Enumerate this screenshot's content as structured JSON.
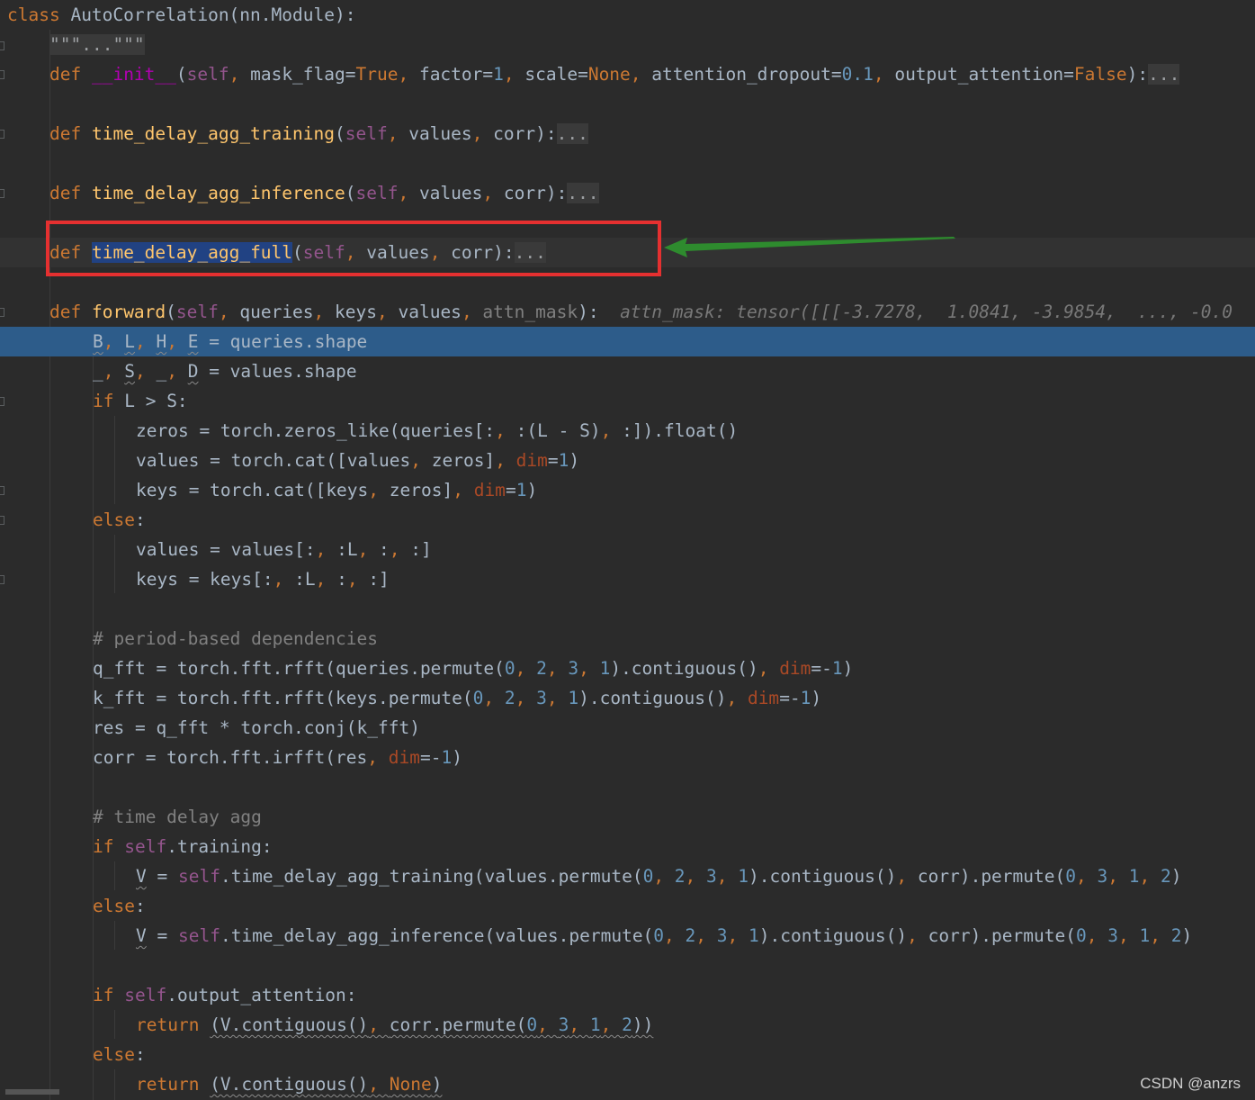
{
  "editor": {
    "lines": [
      {
        "segments": [
          {
            "t": "class ",
            "c": "kw"
          },
          {
            "t": "AutoCorrelation(nn.Module):"
          }
        ]
      },
      {
        "segments": [
          {
            "t": "\"\"\"...\"\"\"",
            "c": "fold-dots"
          }
        ]
      },
      {
        "segments": [
          {
            "t": "def ",
            "c": "kw"
          },
          {
            "t": "__init__",
            "c": "dec"
          },
          {
            "t": "("
          },
          {
            "t": "self",
            "c": "sf"
          },
          {
            "t": ", ",
            "c": "kw"
          },
          {
            "t": "mask_flag="
          },
          {
            "t": "True",
            "c": "kw"
          },
          {
            "t": ", ",
            "c": "kw"
          },
          {
            "t": "factor="
          },
          {
            "t": "1",
            "c": "nm"
          },
          {
            "t": ", ",
            "c": "kw"
          },
          {
            "t": "scale="
          },
          {
            "t": "None",
            "c": "kw"
          },
          {
            "t": ", ",
            "c": "kw"
          },
          {
            "t": "attention_dropout="
          },
          {
            "t": "0.1",
            "c": "nm"
          },
          {
            "t": ", ",
            "c": "kw"
          },
          {
            "t": "output_attention="
          },
          {
            "t": "False",
            "c": "kw"
          },
          {
            "t": "):"
          },
          {
            "t": "...",
            "c": "fold-dots"
          }
        ]
      },
      {
        "segments": []
      },
      {
        "segments": [
          {
            "t": "def ",
            "c": "kw"
          },
          {
            "t": "time_delay_agg_training",
            "c": "fn"
          },
          {
            "t": "("
          },
          {
            "t": "self",
            "c": "sf"
          },
          {
            "t": ", ",
            "c": "kw"
          },
          {
            "t": "values"
          },
          {
            "t": ", ",
            "c": "kw"
          },
          {
            "t": "corr):"
          },
          {
            "t": "...",
            "c": "fold-dots"
          }
        ]
      },
      {
        "segments": []
      },
      {
        "segments": [
          {
            "t": "def ",
            "c": "kw"
          },
          {
            "t": "time_delay_agg_inference",
            "c": "fn"
          },
          {
            "t": "("
          },
          {
            "t": "self",
            "c": "sf"
          },
          {
            "t": ", ",
            "c": "kw"
          },
          {
            "t": "values"
          },
          {
            "t": ", ",
            "c": "kw"
          },
          {
            "t": "corr):"
          },
          {
            "t": "...",
            "c": "fold-dots"
          }
        ]
      },
      {
        "segments": []
      },
      {
        "segments": [
          {
            "t": "def ",
            "c": "kw"
          },
          {
            "t": "time_delay_agg_full",
            "c": "fn ident-hl"
          },
          {
            "t": "("
          },
          {
            "t": "self",
            "c": "sf"
          },
          {
            "t": ", ",
            "c": "kw"
          },
          {
            "t": "values"
          },
          {
            "t": ", ",
            "c": "kw"
          },
          {
            "t": "corr):"
          },
          {
            "t": "...",
            "c": "fold-dots"
          }
        ]
      },
      {
        "segments": []
      },
      {
        "segments": [
          {
            "t": "def ",
            "c": "kw"
          },
          {
            "t": "forward",
            "c": "fn"
          },
          {
            "t": "("
          },
          {
            "t": "self",
            "c": "sf"
          },
          {
            "t": ", ",
            "c": "kw"
          },
          {
            "t": "queries"
          },
          {
            "t": ", ",
            "c": "kw"
          },
          {
            "t": "keys"
          },
          {
            "t": ", ",
            "c": "kw"
          },
          {
            "t": "values"
          },
          {
            "t": ", ",
            "c": "kw"
          },
          {
            "t": "attn_mask",
            "c": "cm"
          },
          {
            "t": "):  "
          },
          {
            "t": "attn_mask: tensor([[[-3.7278,  1.0841, -3.9854,  ..., -0.0",
            "c": "hint"
          }
        ]
      },
      {
        "segments": [
          {
            "t": "B",
            "c": "squig"
          },
          {
            "t": ", ",
            "c": "kw"
          },
          {
            "t": "L",
            "c": "squig"
          },
          {
            "t": ", ",
            "c": "kw"
          },
          {
            "t": "H",
            "c": "squig"
          },
          {
            "t": ", ",
            "c": "kw"
          },
          {
            "t": "E",
            "c": "squig"
          },
          {
            "t": " = queries.shape"
          }
        ]
      },
      {
        "segments": [
          {
            "t": "_"
          },
          {
            "t": ", ",
            "c": "kw"
          },
          {
            "t": "S",
            "c": "squig"
          },
          {
            "t": ", ",
            "c": "kw"
          },
          {
            "t": "_"
          },
          {
            "t": ", ",
            "c": "kw"
          },
          {
            "t": "D",
            "c": "squig"
          },
          {
            "t": " = values.shape"
          }
        ]
      },
      {
        "segments": [
          {
            "t": "if ",
            "c": "kw"
          },
          {
            "t": "L > S:"
          }
        ]
      },
      {
        "segments": [
          {
            "t": "zeros = torch.zeros_like(queries[:"
          },
          {
            "t": ", ",
            "c": "kw"
          },
          {
            "t": ":(L - S)"
          },
          {
            "t": ", ",
            "c": "kw"
          },
          {
            "t": ":]).float()"
          }
        ]
      },
      {
        "segments": [
          {
            "t": "values = torch.cat([values"
          },
          {
            "t": ", ",
            "c": "kw"
          },
          {
            "t": "zeros]"
          },
          {
            "t": ", ",
            "c": "kw"
          },
          {
            "t": "dim",
            "c": "kwarg"
          },
          {
            "t": "="
          },
          {
            "t": "1",
            "c": "nm"
          },
          {
            "t": ")"
          }
        ]
      },
      {
        "segments": [
          {
            "t": "keys = torch.cat([keys"
          },
          {
            "t": ", ",
            "c": "kw"
          },
          {
            "t": "zeros]"
          },
          {
            "t": ", ",
            "c": "kw"
          },
          {
            "t": "dim",
            "c": "kwarg"
          },
          {
            "t": "="
          },
          {
            "t": "1",
            "c": "nm"
          },
          {
            "t": ")"
          }
        ]
      },
      {
        "segments": [
          {
            "t": "else",
            "c": "kw"
          },
          {
            "t": ":"
          }
        ]
      },
      {
        "segments": [
          {
            "t": "values = values[:"
          },
          {
            "t": ", ",
            "c": "kw"
          },
          {
            "t": ":L"
          },
          {
            "t": ", ",
            "c": "kw"
          },
          {
            "t": ":"
          },
          {
            "t": ", ",
            "c": "kw"
          },
          {
            "t": ":]"
          }
        ]
      },
      {
        "segments": [
          {
            "t": "keys = keys[:"
          },
          {
            "t": ", ",
            "c": "kw"
          },
          {
            "t": ":L"
          },
          {
            "t": ", ",
            "c": "kw"
          },
          {
            "t": ":"
          },
          {
            "t": ", ",
            "c": "kw"
          },
          {
            "t": ":]"
          }
        ]
      },
      {
        "segments": []
      },
      {
        "segments": [
          {
            "t": "# period-based dependencies",
            "c": "cm"
          }
        ]
      },
      {
        "segments": [
          {
            "t": "q_fft = torch.fft.rfft(queries.permute("
          },
          {
            "t": "0",
            "c": "nm"
          },
          {
            "t": ", ",
            "c": "kw"
          },
          {
            "t": "2",
            "c": "nm"
          },
          {
            "t": ", ",
            "c": "kw"
          },
          {
            "t": "3",
            "c": "nm"
          },
          {
            "t": ", ",
            "c": "kw"
          },
          {
            "t": "1",
            "c": "nm"
          },
          {
            "t": ").contiguous()"
          },
          {
            "t": ", ",
            "c": "kw"
          },
          {
            "t": "dim",
            "c": "kwarg"
          },
          {
            "t": "=-"
          },
          {
            "t": "1",
            "c": "nm"
          },
          {
            "t": ")"
          }
        ]
      },
      {
        "segments": [
          {
            "t": "k_fft = torch.fft.rfft(keys.permute("
          },
          {
            "t": "0",
            "c": "nm"
          },
          {
            "t": ", ",
            "c": "kw"
          },
          {
            "t": "2",
            "c": "nm"
          },
          {
            "t": ", ",
            "c": "kw"
          },
          {
            "t": "3",
            "c": "nm"
          },
          {
            "t": ", ",
            "c": "kw"
          },
          {
            "t": "1",
            "c": "nm"
          },
          {
            "t": ").contiguous()"
          },
          {
            "t": ", ",
            "c": "kw"
          },
          {
            "t": "dim",
            "c": "kwarg"
          },
          {
            "t": "=-"
          },
          {
            "t": "1",
            "c": "nm"
          },
          {
            "t": ")"
          }
        ]
      },
      {
        "segments": [
          {
            "t": "res = q_fft * torch.conj(k_fft)"
          }
        ]
      },
      {
        "segments": [
          {
            "t": "corr = torch.fft.irfft(res"
          },
          {
            "t": ", ",
            "c": "kw"
          },
          {
            "t": "dim",
            "c": "kwarg"
          },
          {
            "t": "=-"
          },
          {
            "t": "1",
            "c": "nm"
          },
          {
            "t": ")"
          }
        ]
      },
      {
        "segments": []
      },
      {
        "segments": [
          {
            "t": "# time delay agg",
            "c": "cm"
          }
        ]
      },
      {
        "segments": [
          {
            "t": "if ",
            "c": "kw"
          },
          {
            "t": "self",
            "c": "sf"
          },
          {
            "t": ".training:"
          }
        ]
      },
      {
        "segments": [
          {
            "t": "V",
            "c": "squig"
          },
          {
            "t": " = "
          },
          {
            "t": "self",
            "c": "sf"
          },
          {
            "t": ".time_delay_agg_training(values.permute("
          },
          {
            "t": "0",
            "c": "nm"
          },
          {
            "t": ", ",
            "c": "kw"
          },
          {
            "t": "2",
            "c": "nm"
          },
          {
            "t": ", ",
            "c": "kw"
          },
          {
            "t": "3",
            "c": "nm"
          },
          {
            "t": ", ",
            "c": "kw"
          },
          {
            "t": "1",
            "c": "nm"
          },
          {
            "t": ").contiguous()"
          },
          {
            "t": ", ",
            "c": "kw"
          },
          {
            "t": "corr).permute("
          },
          {
            "t": "0",
            "c": "nm"
          },
          {
            "t": ", ",
            "c": "kw"
          },
          {
            "t": "3",
            "c": "nm"
          },
          {
            "t": ", ",
            "c": "kw"
          },
          {
            "t": "1",
            "c": "nm"
          },
          {
            "t": ", ",
            "c": "kw"
          },
          {
            "t": "2",
            "c": "nm"
          },
          {
            "t": ")"
          }
        ]
      },
      {
        "segments": [
          {
            "t": "else",
            "c": "kw"
          },
          {
            "t": ":"
          }
        ]
      },
      {
        "segments": [
          {
            "t": "V",
            "c": "squig"
          },
          {
            "t": " = "
          },
          {
            "t": "self",
            "c": "sf"
          },
          {
            "t": ".time_delay_agg_inference(values.permute("
          },
          {
            "t": "0",
            "c": "nm"
          },
          {
            "t": ", ",
            "c": "kw"
          },
          {
            "t": "2",
            "c": "nm"
          },
          {
            "t": ", ",
            "c": "kw"
          },
          {
            "t": "3",
            "c": "nm"
          },
          {
            "t": ", ",
            "c": "kw"
          },
          {
            "t": "1",
            "c": "nm"
          },
          {
            "t": ").contiguous()"
          },
          {
            "t": ", ",
            "c": "kw"
          },
          {
            "t": "corr).permute("
          },
          {
            "t": "0",
            "c": "nm"
          },
          {
            "t": ", ",
            "c": "kw"
          },
          {
            "t": "3",
            "c": "nm"
          },
          {
            "t": ", ",
            "c": "kw"
          },
          {
            "t": "1",
            "c": "nm"
          },
          {
            "t": ", ",
            "c": "kw"
          },
          {
            "t": "2",
            "c": "nm"
          },
          {
            "t": ")"
          }
        ]
      },
      {
        "segments": []
      },
      {
        "segments": [
          {
            "t": "if ",
            "c": "kw"
          },
          {
            "t": "self",
            "c": "sf"
          },
          {
            "t": ".output_attention:"
          }
        ]
      },
      {
        "segments": [
          {
            "t": "return ",
            "c": "kw"
          },
          {
            "t": "(V.contiguous()",
            "c": "squig"
          },
          {
            "t": ", ",
            "c": "kw squig"
          },
          {
            "t": "corr.permute(",
            "c": "squig"
          },
          {
            "t": "0",
            "c": "nm squig"
          },
          {
            "t": ", ",
            "c": "kw squig"
          },
          {
            "t": "3",
            "c": "nm squig"
          },
          {
            "t": ", ",
            "c": "kw squig"
          },
          {
            "t": "1",
            "c": "nm squig"
          },
          {
            "t": ", ",
            "c": "kw squig"
          },
          {
            "t": "2",
            "c": "nm squig"
          },
          {
            "t": "))",
            "c": "squig"
          }
        ]
      },
      {
        "segments": [
          {
            "t": "else",
            "c": "kw"
          },
          {
            "t": ":"
          }
        ]
      },
      {
        "segments": [
          {
            "t": "return ",
            "c": "kw"
          },
          {
            "t": "(V.contiguous()",
            "c": "squig"
          },
          {
            "t": ", ",
            "c": "kw squig"
          },
          {
            "t": "None",
            "c": "kw squig"
          },
          {
            "t": ")",
            "c": "squig"
          }
        ]
      }
    ]
  },
  "watermark": "CSDN @anzrs",
  "colors": {
    "background": "#2b2b2b",
    "selected_line": "#2d5c8a",
    "annotation_box": "#e53030",
    "annotation_arrow": "#2e8b2e"
  }
}
